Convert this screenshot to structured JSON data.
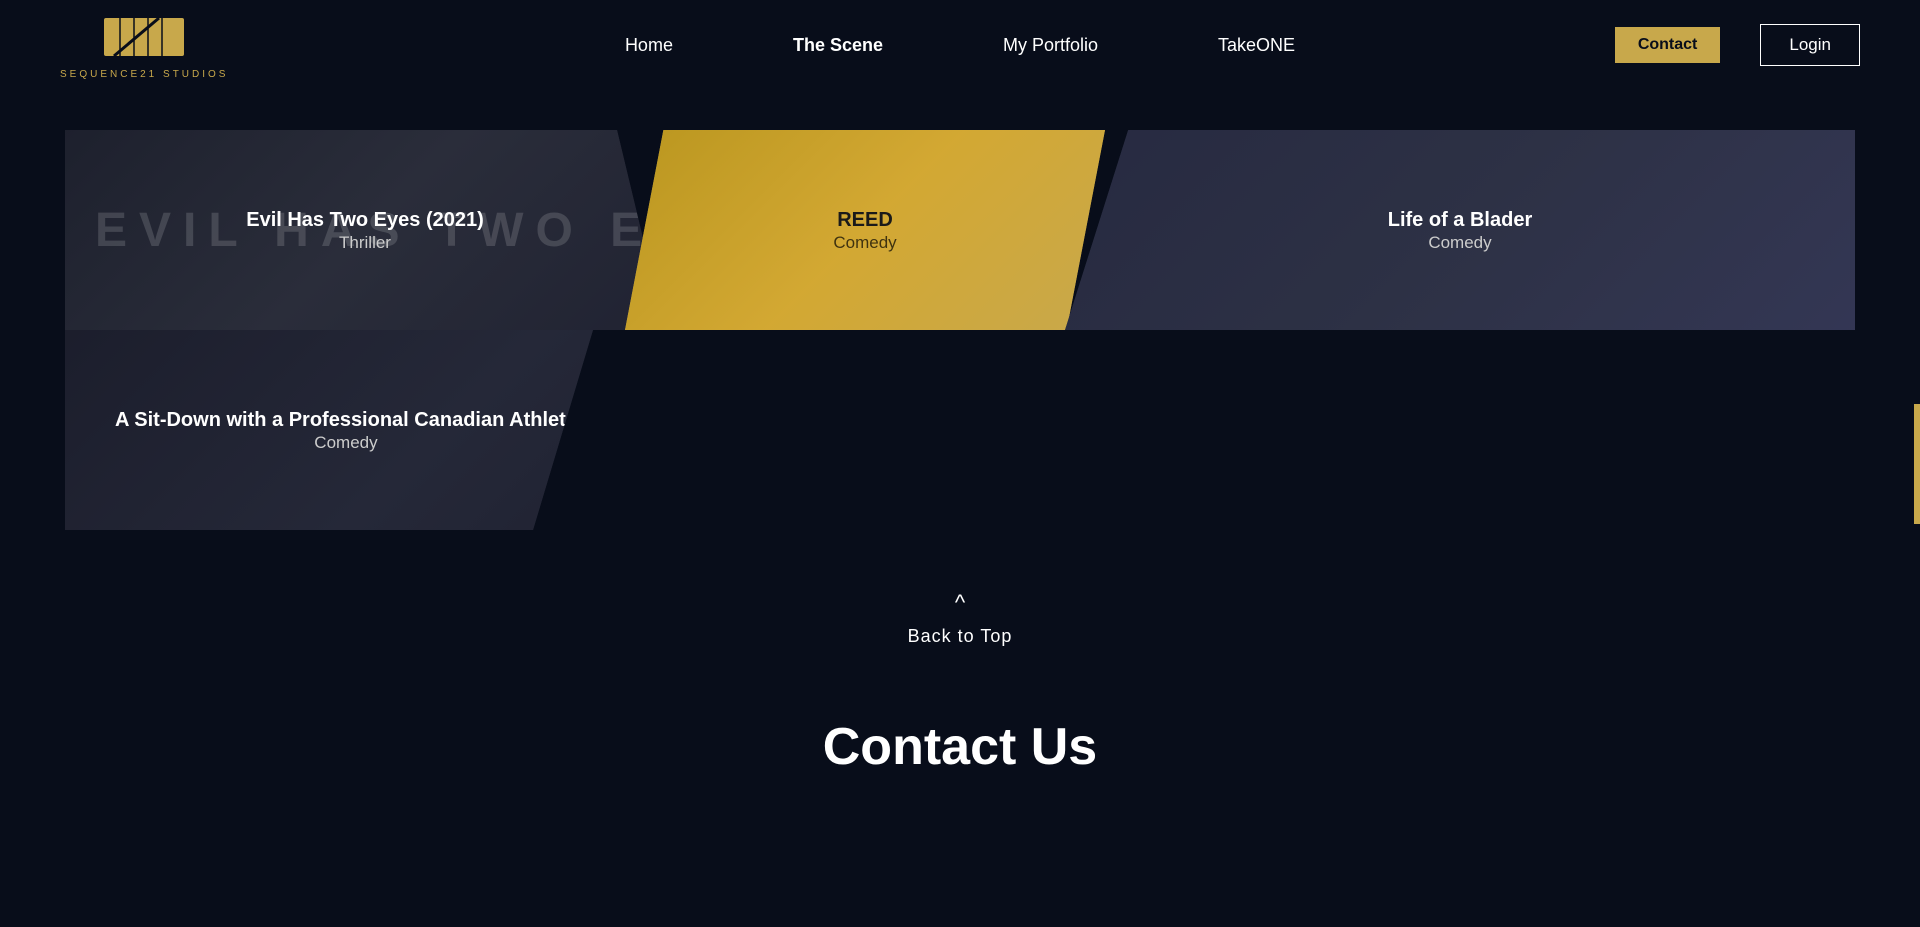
{
  "header": {
    "logo_text": "SEQUENCE21 STUDIOS",
    "nav_items": [
      {
        "label": "Home",
        "active": false
      },
      {
        "label": "The Scene",
        "active": true
      },
      {
        "label": "My Portfolio",
        "active": false
      },
      {
        "label": "TakeONE",
        "active": false
      }
    ],
    "contact_label": "Contact",
    "login_label": "Login"
  },
  "cards": [
    {
      "id": "card-1",
      "title": "Evil Has Two Eyes (2021)",
      "genre": "Thriller",
      "bg_text": "EVIL HAS TWO EYES",
      "style": "dark"
    },
    {
      "id": "card-2",
      "title": "REED",
      "genre": "Comedy",
      "style": "gold"
    },
    {
      "id": "card-3",
      "title": "Life of a Blader",
      "genre": "Comedy",
      "style": "dark-blue"
    },
    {
      "id": "card-4",
      "title": "A Sit-Down with a Professional Canadian Athlete",
      "genre": "Comedy",
      "style": "dark"
    }
  ],
  "back_to_top": {
    "label": "Back to Top",
    "arrow": "^"
  },
  "contact": {
    "title": "Contact Us"
  },
  "accent": {
    "color": "#c8a84b"
  }
}
